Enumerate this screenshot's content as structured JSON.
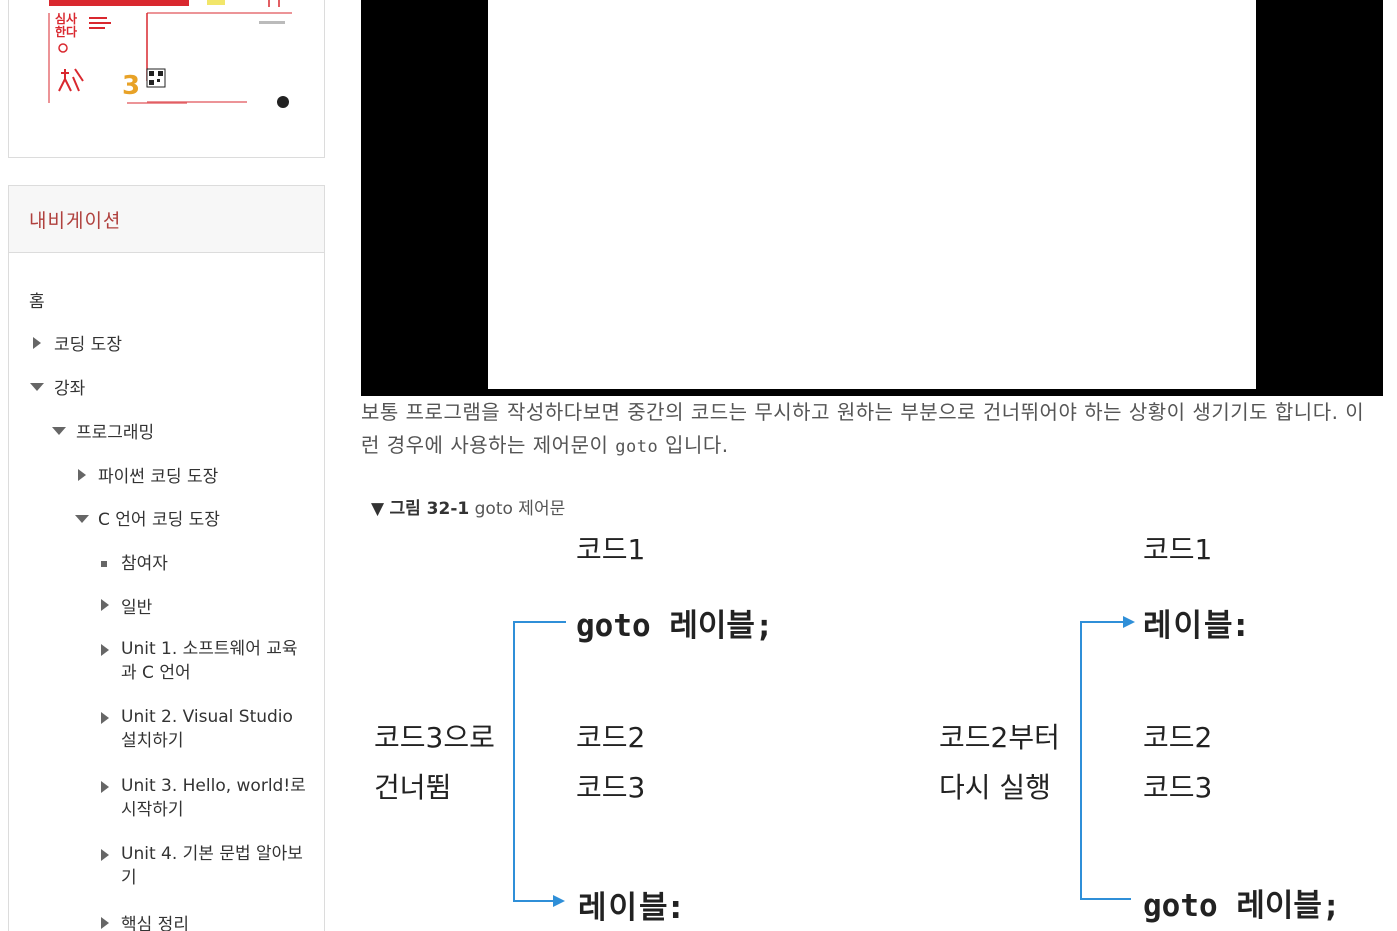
{
  "book": {
    "title_line": "심사\n한다",
    "volume": "3"
  },
  "navigation": {
    "header": "내비게이션",
    "items": [
      {
        "label": "홈"
      },
      {
        "label": "코딩 도장"
      },
      {
        "label": "강좌"
      },
      {
        "label": "프로그래밍"
      },
      {
        "label": "파이썬 코딩 도장"
      },
      {
        "label": "C 언어 코딩 도장"
      },
      {
        "label": "참여자"
      },
      {
        "label": "일반"
      },
      {
        "label": "Unit 1. 소프트웨어 교육과 C 언어"
      },
      {
        "label": "Unit 2. Visual Studio 설치하기"
      },
      {
        "label": "Unit 3. Hello, world!로 시작하기"
      },
      {
        "label": "Unit 4. 기본 문법 알아보기"
      },
      {
        "label": "핵심 정리"
      }
    ]
  },
  "content": {
    "paragraph_before": "보통 프로그램을 작성하다보면 중간의 코드는 무시하고 원하는 부분으로 건너뛰어야 하는 상황이 생기기도 합니다. 이런 경우에 사용하는 제어문이 ",
    "paragraph_code": "goto",
    "paragraph_after": " 입니다.",
    "figure_caption_marker": "▼",
    "figure_caption_bold": "그림 32-1",
    "figure_caption_rest": " goto 제어문",
    "diagram": {
      "left": {
        "code1": "코드1",
        "goto_label": "goto 레이블;",
        "side_line1": "코드3으로",
        "side_line2": "건너뜀",
        "code2": "코드2",
        "code3": "코드3",
        "label_target": "레이블:"
      },
      "right": {
        "code1": "코드1",
        "label_target": "레이블:",
        "side_line1": "코드2부터",
        "side_line2": "다시 실행",
        "code2": "코드2",
        "code3": "코드3",
        "goto_label": "goto 레이블;"
      }
    }
  },
  "colors": {
    "nav_header_text": "#b0413e",
    "arrow": "#2f8fd8",
    "video_bg": "#000000"
  }
}
